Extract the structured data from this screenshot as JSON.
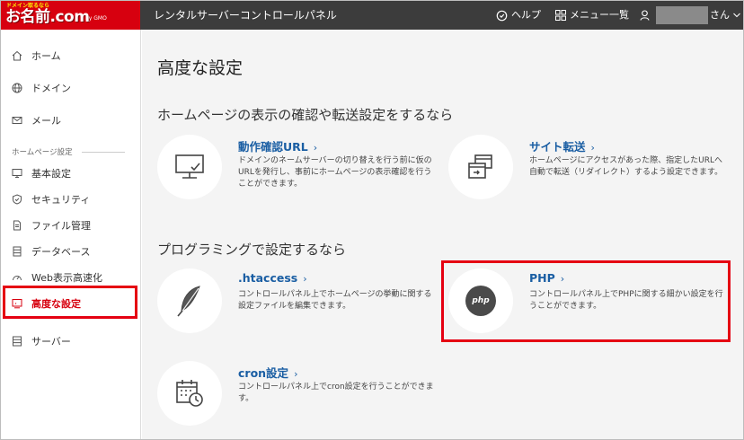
{
  "header": {
    "logo_tagline": "ドメイン取るなら",
    "logo_main": "お名前.com",
    "logo_sub": "by GMO",
    "app_title": "レンタルサーバーコントロールパネル",
    "help_label": "ヘルプ",
    "menu_label": "メニュー一覧",
    "user_suffix": "さん",
    "bg_color": "#3c3c3c",
    "logo_color": "#d7000f"
  },
  "sidebar": {
    "items_top": [
      {
        "label": "ホーム",
        "icon": "home-icon"
      },
      {
        "label": "ドメイン",
        "icon": "globe-icon"
      },
      {
        "label": "メール",
        "icon": "mail-icon"
      }
    ],
    "group_label": "ホームページ設定",
    "items_group": [
      {
        "label": "基本設定",
        "icon": "monitor-icon"
      },
      {
        "label": "セキュリティ",
        "icon": "shield-icon"
      },
      {
        "label": "ファイル管理",
        "icon": "file-icon"
      },
      {
        "label": "データベース",
        "icon": "database-icon"
      },
      {
        "label": "Web表示高速化",
        "icon": "speedometer-icon"
      },
      {
        "label": "高度な設定",
        "icon": "advanced-settings-icon",
        "active": true
      }
    ],
    "items_bottom": [
      {
        "label": "サーバー",
        "icon": "server-icon"
      }
    ]
  },
  "main": {
    "page_title": "高度な設定",
    "sections": [
      {
        "title": "ホームページの表示の確認や転送設定をするなら",
        "cards": [
          {
            "title": "動作確認URL",
            "chevron": "›",
            "icon": "monitor-check-icon",
            "desc": "ドメインのネームサーバーの切り替えを行う前に仮のURLを発行し、事前にホームページの表示確認を行うことができます。"
          },
          {
            "title": "サイト転送",
            "chevron": "›",
            "icon": "redirect-windows-icon",
            "desc": "ホームページにアクセスがあった際、指定したURLへ自動で転送（リダイレクト）するよう設定できます。"
          }
        ]
      },
      {
        "title": "プログラミングで設定するなら",
        "cards": [
          {
            "title": ".htaccess",
            "chevron": "›",
            "icon": "feather-icon",
            "desc": "コントロールパネル上でホームページの挙動に関する設定ファイルを編集できます。"
          },
          {
            "title": "PHP",
            "chevron": "›",
            "icon": "php-icon",
            "icon_text": "php",
            "desc": "コントロールパネル上でPHPに関する細かい設定を行うことができます。"
          },
          {
            "title": "cron設定",
            "chevron": "›",
            "icon": "calendar-clock-icon",
            "desc": "コントロールパネル上でcron設定を行うことができます。"
          }
        ]
      }
    ],
    "highlight_color": "#e50012",
    "link_color": "#1a5ea3"
  }
}
